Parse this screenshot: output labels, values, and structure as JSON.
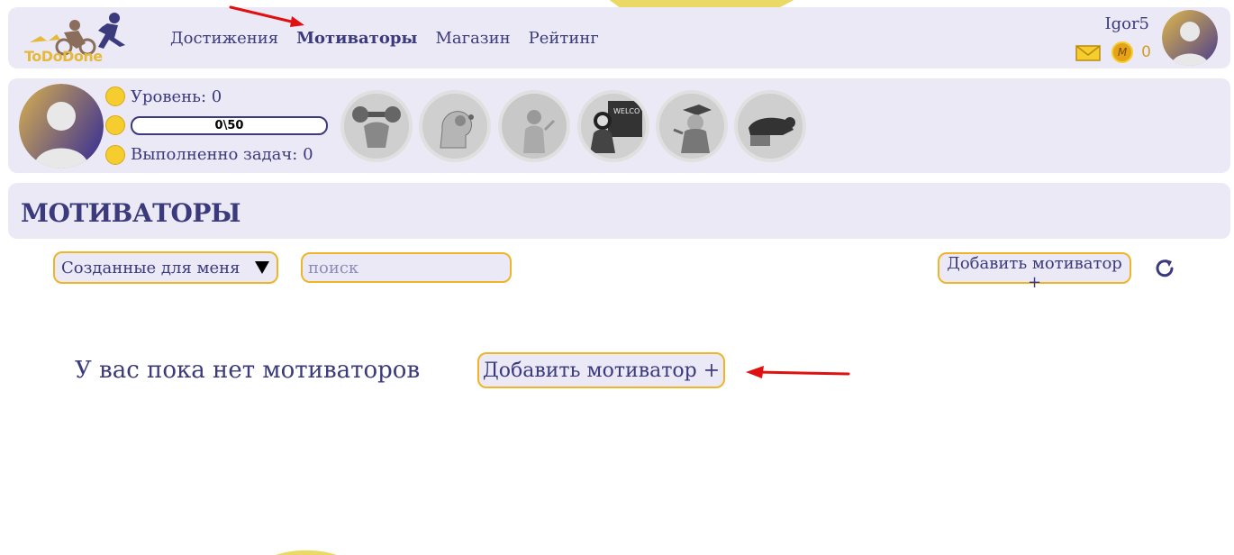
{
  "brand": {
    "logo_text": "ToDoDone"
  },
  "nav": {
    "links": [
      {
        "label": "Достижения",
        "active": false
      },
      {
        "label": "Мотиваторы",
        "active": true
      },
      {
        "label": "Магазин",
        "active": false
      },
      {
        "label": "Рейтинг",
        "active": false
      }
    ]
  },
  "user": {
    "name": "Igor5",
    "coins": "0",
    "icons": [
      "mail-icon",
      "coin-icon"
    ]
  },
  "profile": {
    "level_text": "Уровень: 0",
    "xp_text": "0\\50",
    "tasks_text": "Выполненно задач: 0",
    "achievements": [
      "muscle-achievement",
      "brain-achievement",
      "speaker-achievement",
      "teacher-achievement",
      "graduate-achievement",
      "cat-achievement"
    ]
  },
  "page": {
    "title": "МОТИВАТОРЫ"
  },
  "filters": {
    "selected": "Созданные для меня",
    "search_placeholder": "поиск"
  },
  "actions": {
    "add_button": "Добавить мотиватор +",
    "refresh_icon": "refresh-icon"
  },
  "empty_state": {
    "message": "У вас пока нет мотиваторов",
    "add_button": "Добавить мотиватор +"
  },
  "colors": {
    "accent": "#3b3a7c",
    "border": "#f0b429",
    "panel": "#ebe9f6",
    "annotation": "#e01010"
  }
}
